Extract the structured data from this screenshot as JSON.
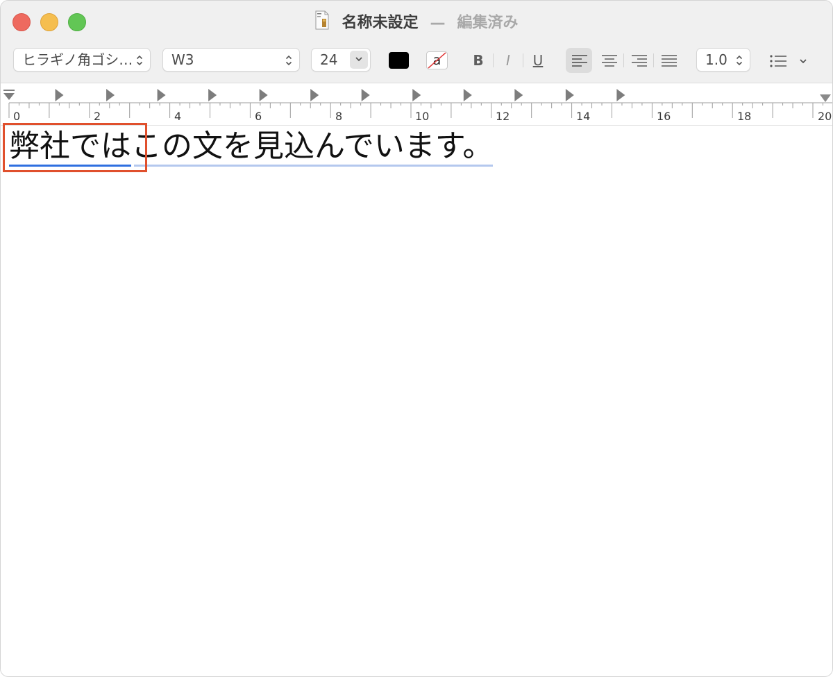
{
  "window": {
    "title": "名称未設定",
    "title_separator": "—",
    "edited_label": "編集済み"
  },
  "toolbar": {
    "font_family": "ヒラギノ角ゴシ…",
    "font_weight": "W3",
    "font_size": "24",
    "text_color": "#000000",
    "background_color_glyph": "a",
    "bold_label": "B",
    "italic_label": "I",
    "underline_label": "U",
    "line_spacing": "1.0",
    "active_alignment": "left"
  },
  "ruler": {
    "labels": [
      "0",
      "2",
      "4",
      "6",
      "8",
      "10",
      "12",
      "14",
      "16",
      "18",
      "20"
    ]
  },
  "document": {
    "selected_word": "弊社では",
    "rest_text": "この文を見込んでいます。"
  },
  "colors": {
    "selection_underline": "#2f6fe0",
    "secondary_underline": "#b4c8ee",
    "highlight_box": "#e0502d"
  }
}
